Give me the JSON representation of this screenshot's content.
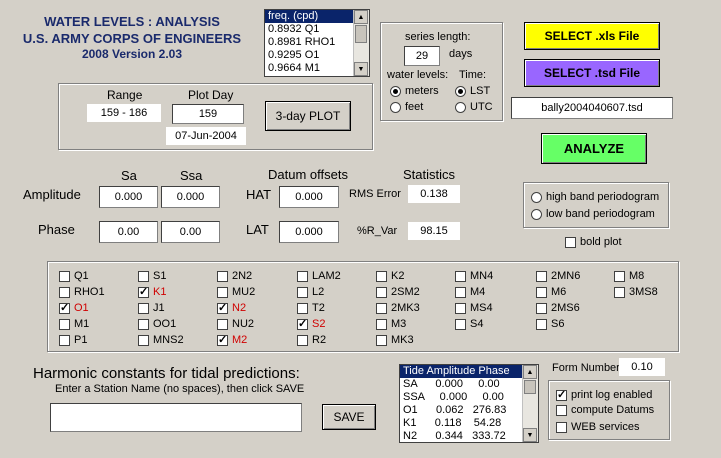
{
  "header": {
    "line1": "WATER LEVELS :  ANALYSIS",
    "line2": "U.S. ARMY CORPS OF ENGINEERS",
    "line3": "2008 Version 2.03"
  },
  "freq_list": {
    "header": "freq. (cpd)",
    "rows": [
      "0.8932   Q1",
      "0.8981 RHO1",
      "0.9295   O1",
      "0.9664   M1"
    ]
  },
  "range": {
    "label": "Range",
    "value": "159 - 186"
  },
  "plot_day": {
    "label": "Plot Day",
    "value": "159",
    "date": "07-Jun-2004"
  },
  "three_day_plot": "3-day PLOT",
  "series": {
    "label": "series length:",
    "value": "29",
    "unit": "days",
    "water_levels_label": "water levels:",
    "time_label": "Time:",
    "meters": "meters",
    "feet": "feet",
    "lst": "LST",
    "utc": "UTC"
  },
  "select_xls": "SELECT .xls File",
  "select_tsd": "SELECT .tsd File",
  "filename": "bally2004040607.tsd",
  "analyze": "ANALYZE",
  "table_headers": {
    "sa": "Sa",
    "ssa": "Ssa",
    "datum": "Datum offsets",
    "stats": "Statistics"
  },
  "amplitude": {
    "label": "Amplitude",
    "sa": "0.000",
    "ssa": "0.000"
  },
  "phase": {
    "label": "Phase",
    "sa": "0.00",
    "ssa": "0.00"
  },
  "hat": {
    "label": "HAT",
    "value": "0.000"
  },
  "lat": {
    "label": "LAT",
    "value": "0.000"
  },
  "rms": {
    "label": "RMS Error",
    "value": "0.138"
  },
  "rvar": {
    "label": "%R_Var",
    "value": "98.15"
  },
  "periodogram": {
    "high": "high band periodogram",
    "low": "low band periodogram"
  },
  "bold_plot": "bold plot",
  "constituents": [
    [
      "Q1",
      "RHO1",
      "O1",
      "M1",
      "P1"
    ],
    [
      "S1",
      "K1",
      "J1",
      "OO1",
      "MNS2"
    ],
    [
      "2N2",
      "MU2",
      "N2",
      "NU2",
      "M2"
    ],
    [
      "LAM2",
      "L2",
      "T2",
      "S2",
      "R2"
    ],
    [
      "K2",
      "2SM2",
      "2MK3",
      "M3",
      "MK3"
    ],
    [
      "MN4",
      "M4",
      "MS4",
      "S4"
    ],
    [
      "2MN6",
      "M6",
      "2MS6",
      "S6"
    ],
    [
      "M8",
      "3MS8"
    ]
  ],
  "checked": [
    "O1",
    "K1",
    "N2",
    "M2",
    "S2"
  ],
  "harmonic": {
    "title": "Harmonic constants for tidal predictions:",
    "instructions": "Enter a Station Name (no spaces), then click SAVE",
    "station_value": "",
    "save": "SAVE"
  },
  "tide_list": {
    "header": "Tide Amplitude Phase",
    "rows": [
      "SA      0.000     0.00",
      "SSA     0.000     0.00",
      "O1      0.062   276.83",
      "K1      0.118    54.28",
      "N2      0.344   333.72"
    ]
  },
  "form_number": {
    "label": "Form Number",
    "value": "0.10"
  },
  "options": {
    "print_log": "print log enabled",
    "compute_datums": "compute Datums",
    "web": "WEB services"
  }
}
